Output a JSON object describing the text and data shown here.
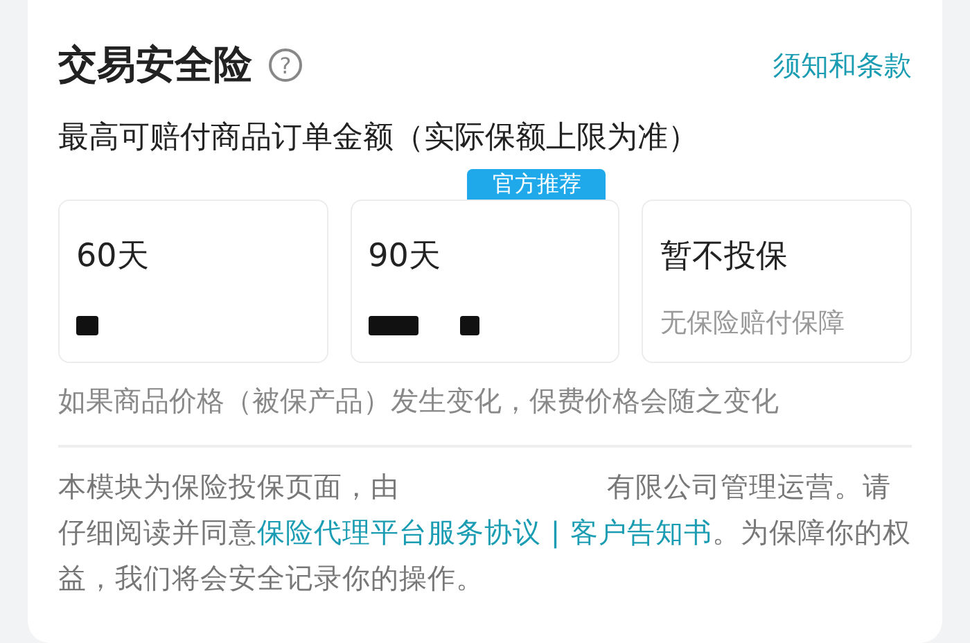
{
  "title": "交易安全险",
  "help_icon": "?",
  "terms_link": "须知和条款",
  "subtitle": "最高可赔付商品订单金额（实际保额上限为准）",
  "options": [
    {
      "kind": "plan",
      "label": "60天"
    },
    {
      "kind": "plan",
      "label": "90天",
      "badge": "官方推荐"
    },
    {
      "kind": "none",
      "label": "暂不投保",
      "description": "无保险赔付保障"
    }
  ],
  "price_note": "如果商品价格（被保产品）发生变化，保费价格会随之变化",
  "disclaimer": {
    "before": "本模块为保险投保页面，由",
    "after": "有限公司管理运营。请仔细阅读并同意",
    "links": [
      "保险代理平台服务协议",
      "客户告知书"
    ],
    "separator": " | ",
    "end": "。为保障你的权益，我们将会安全记录你的操作。"
  }
}
